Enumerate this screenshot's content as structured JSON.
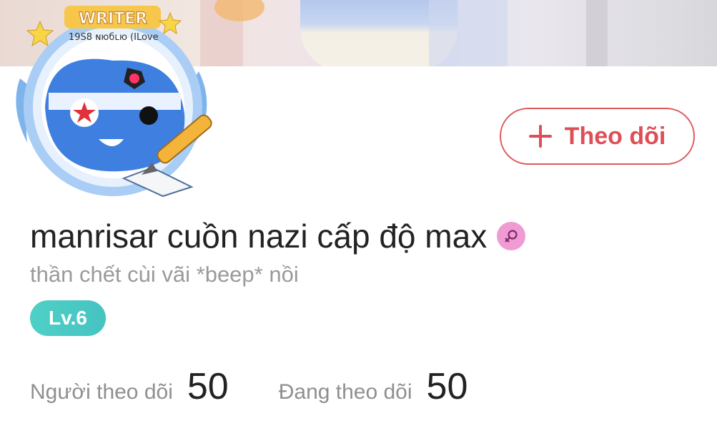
{
  "avatar": {
    "badge_text": "WRITER",
    "doodle_text": "19S8 ɴюбʟю (ILove"
  },
  "follow_button": {
    "label": "Theo dõi",
    "icon": "plus-icon"
  },
  "profile": {
    "name": "manrisar cuồn nazi cấp độ max",
    "gender_icon": "female-icon",
    "bio": "thần chết cùi vãi *beep* nồi",
    "level": "Lv.6"
  },
  "stats": {
    "followers_label": "Người theo dõi",
    "followers_value": "50",
    "following_label": "Đang theo dõi",
    "following_value": "50"
  },
  "colors": {
    "accent_red": "#dd4f57",
    "level_teal": "#4fd0c7",
    "gender_pink": "#f09bd4",
    "avatar_blue": "#3e7fe0"
  }
}
